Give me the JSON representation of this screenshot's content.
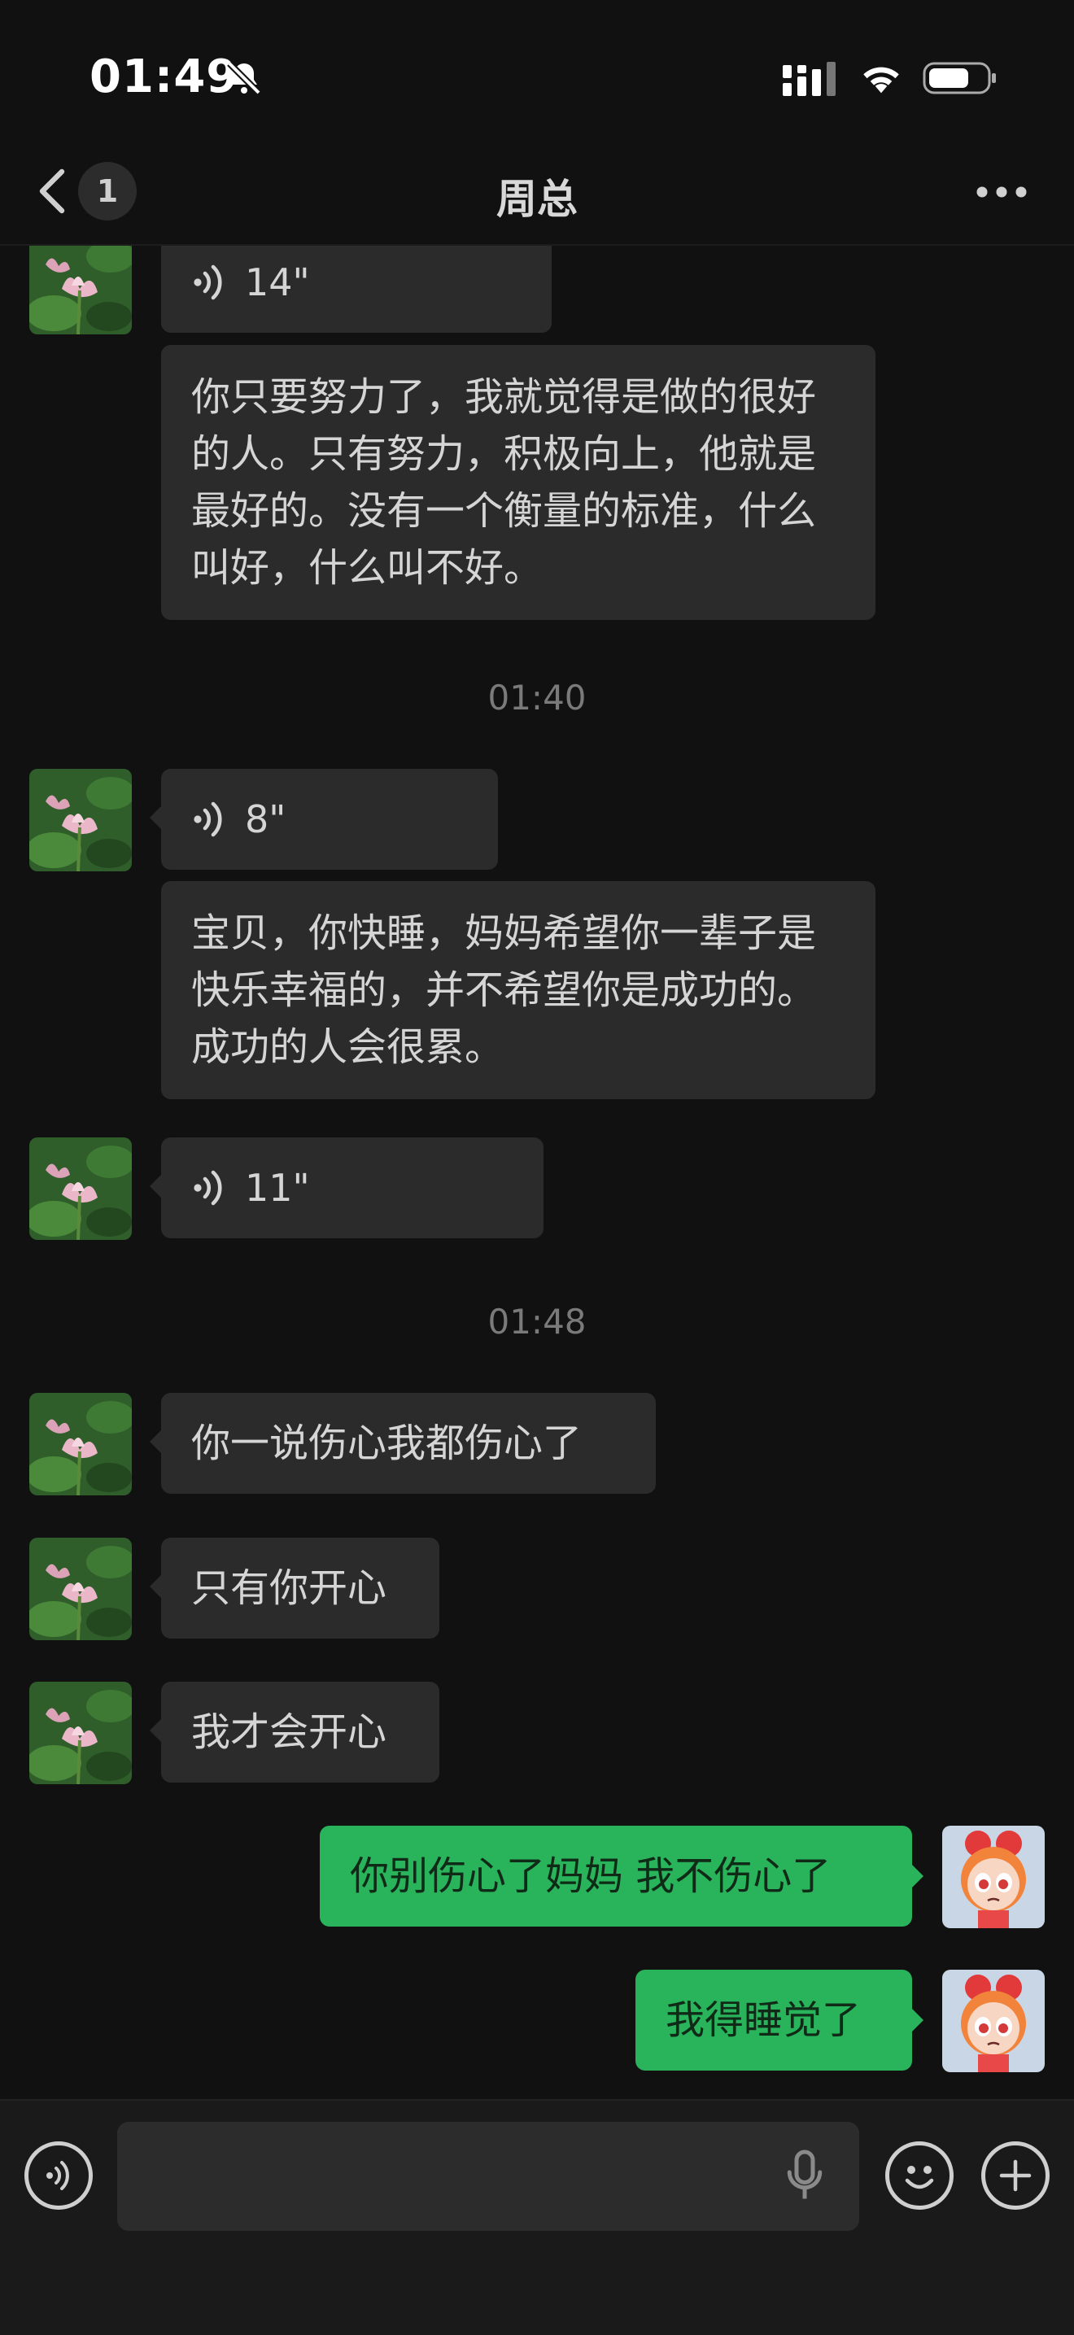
{
  "status_bar": {
    "time": "01:49"
  },
  "header": {
    "unread_count": "1",
    "title": "周总"
  },
  "messages": {
    "m1_duration": "14\"",
    "m1_text": "你只要努力了，我就觉得是做的很好的人。只有努力，积极向上，他就是最好的。没有一个衡量的标准，什么叫好，什么叫不好。",
    "time1": "01:40",
    "m2_duration": "8\"",
    "m2_text": "宝贝，你快睡，妈妈希望你一辈子是快乐幸福的，并不希望你是成功的。成功的人会很累。",
    "m3_duration": "11\"",
    "time2": "01:48",
    "m4_text": "你一说伤心我都伤心了",
    "m5_text": "只有你开心",
    "m6_text": "我才会开心",
    "m7_text": "你别伤心了妈妈 我不伤心了",
    "m8_text": "我得睡觉了"
  },
  "input": {
    "value": "",
    "placeholder": ""
  },
  "colors": {
    "background": "#111111",
    "incoming_bubble": "#2b2b2b",
    "outgoing_bubble": "#29b35b"
  }
}
